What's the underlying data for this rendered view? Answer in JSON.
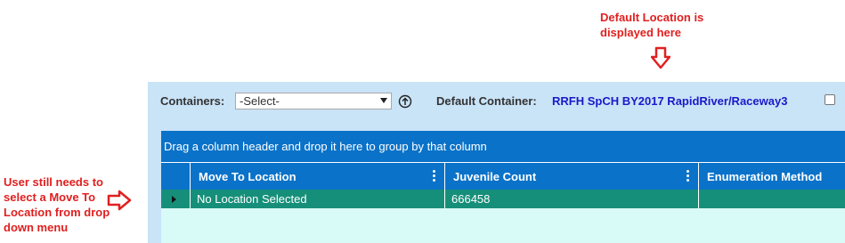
{
  "annotations": {
    "top_line1": "Default Location is",
    "top_line2": "displayed here",
    "left_line1": "User still needs to",
    "left_line2": "select a Move To",
    "left_line3": "Location from drop",
    "left_line4": "down menu",
    "color": "#e02020"
  },
  "toolbar": {
    "containers_label": "Containers:",
    "containers_selected": "-Select-",
    "upload_icon": "circle-arrow-up-icon",
    "default_container_label": "Default Container:",
    "default_container_value": "RRFH SpCH BY2017 RapidRiver/Raceway3"
  },
  "grid": {
    "group_hint": "Drag a column header and drop it here to group by that column",
    "columns": [
      "Move To Location",
      "Juvenile Count",
      "Enumeration Method"
    ],
    "rows": [
      {
        "move_to_location": "No Location Selected",
        "juvenile_count": "666458",
        "enumeration_method": ""
      }
    ],
    "header_color": "#0a72c8",
    "row_color": "#168f7a"
  }
}
